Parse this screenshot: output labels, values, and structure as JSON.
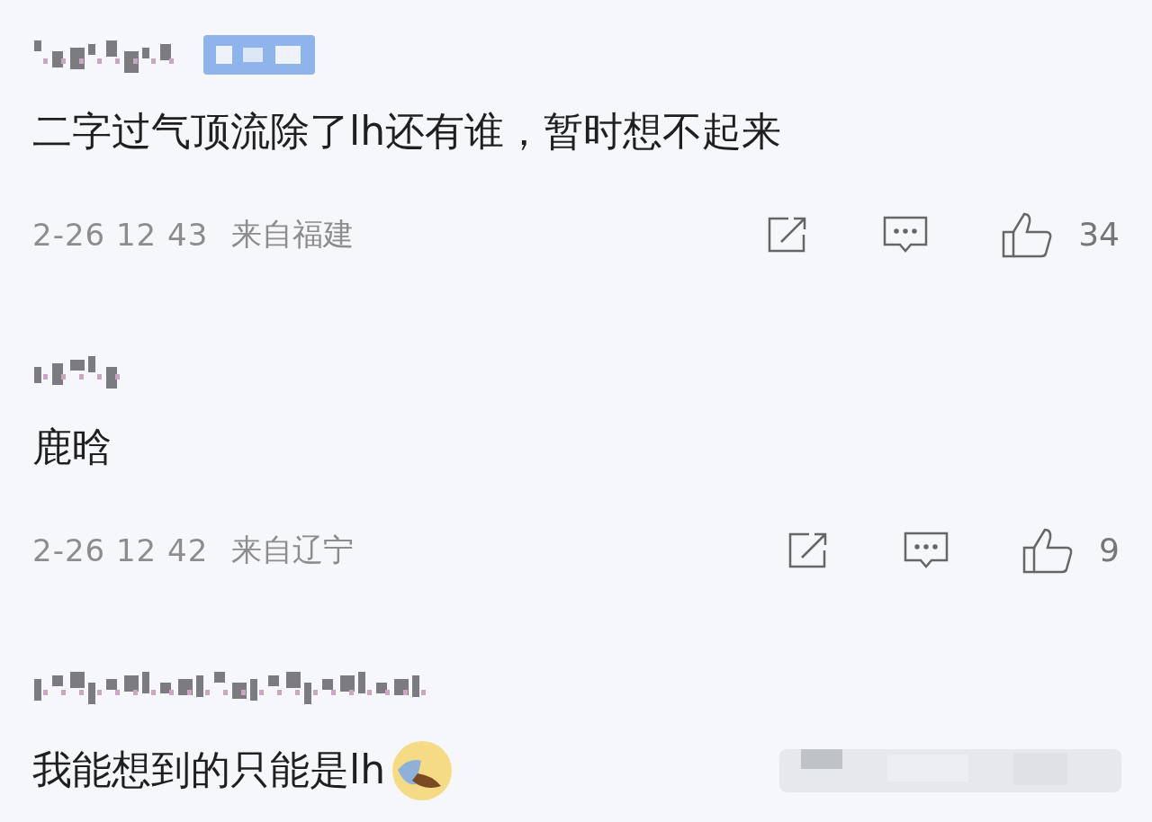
{
  "comments": [
    {
      "badge": true,
      "text": "二字过气顶流除了lh还有谁，暂时想不起来",
      "time": "2-26 12 43",
      "source": "来自福建",
      "likes": "34"
    },
    {
      "text": "鹿晗",
      "time": "2-26 12 42",
      "source": "来自辽宁",
      "likes": "9"
    },
    {
      "text": "我能想到的只能是lh",
      "emoji": true,
      "blurred_tail": true
    }
  ]
}
